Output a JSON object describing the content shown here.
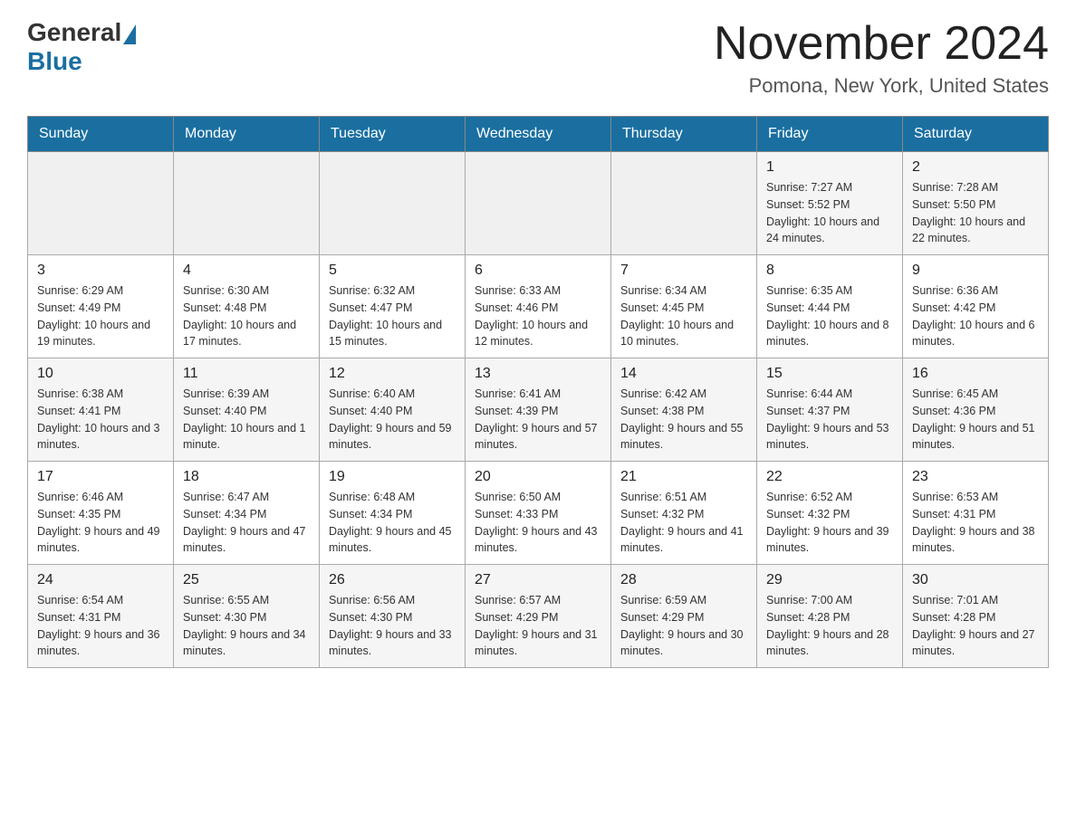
{
  "header": {
    "logo_general": "General",
    "logo_blue": "Blue",
    "month_title": "November 2024",
    "location": "Pomona, New York, United States"
  },
  "weekdays": [
    "Sunday",
    "Monday",
    "Tuesday",
    "Wednesday",
    "Thursday",
    "Friday",
    "Saturday"
  ],
  "weeks": [
    [
      {
        "day": "",
        "info": ""
      },
      {
        "day": "",
        "info": ""
      },
      {
        "day": "",
        "info": ""
      },
      {
        "day": "",
        "info": ""
      },
      {
        "day": "",
        "info": ""
      },
      {
        "day": "1",
        "info": "Sunrise: 7:27 AM\nSunset: 5:52 PM\nDaylight: 10 hours and 24 minutes."
      },
      {
        "day": "2",
        "info": "Sunrise: 7:28 AM\nSunset: 5:50 PM\nDaylight: 10 hours and 22 minutes."
      }
    ],
    [
      {
        "day": "3",
        "info": "Sunrise: 6:29 AM\nSunset: 4:49 PM\nDaylight: 10 hours and 19 minutes."
      },
      {
        "day": "4",
        "info": "Sunrise: 6:30 AM\nSunset: 4:48 PM\nDaylight: 10 hours and 17 minutes."
      },
      {
        "day": "5",
        "info": "Sunrise: 6:32 AM\nSunset: 4:47 PM\nDaylight: 10 hours and 15 minutes."
      },
      {
        "day": "6",
        "info": "Sunrise: 6:33 AM\nSunset: 4:46 PM\nDaylight: 10 hours and 12 minutes."
      },
      {
        "day": "7",
        "info": "Sunrise: 6:34 AM\nSunset: 4:45 PM\nDaylight: 10 hours and 10 minutes."
      },
      {
        "day": "8",
        "info": "Sunrise: 6:35 AM\nSunset: 4:44 PM\nDaylight: 10 hours and 8 minutes."
      },
      {
        "day": "9",
        "info": "Sunrise: 6:36 AM\nSunset: 4:42 PM\nDaylight: 10 hours and 6 minutes."
      }
    ],
    [
      {
        "day": "10",
        "info": "Sunrise: 6:38 AM\nSunset: 4:41 PM\nDaylight: 10 hours and 3 minutes."
      },
      {
        "day": "11",
        "info": "Sunrise: 6:39 AM\nSunset: 4:40 PM\nDaylight: 10 hours and 1 minute."
      },
      {
        "day": "12",
        "info": "Sunrise: 6:40 AM\nSunset: 4:40 PM\nDaylight: 9 hours and 59 minutes."
      },
      {
        "day": "13",
        "info": "Sunrise: 6:41 AM\nSunset: 4:39 PM\nDaylight: 9 hours and 57 minutes."
      },
      {
        "day": "14",
        "info": "Sunrise: 6:42 AM\nSunset: 4:38 PM\nDaylight: 9 hours and 55 minutes."
      },
      {
        "day": "15",
        "info": "Sunrise: 6:44 AM\nSunset: 4:37 PM\nDaylight: 9 hours and 53 minutes."
      },
      {
        "day": "16",
        "info": "Sunrise: 6:45 AM\nSunset: 4:36 PM\nDaylight: 9 hours and 51 minutes."
      }
    ],
    [
      {
        "day": "17",
        "info": "Sunrise: 6:46 AM\nSunset: 4:35 PM\nDaylight: 9 hours and 49 minutes."
      },
      {
        "day": "18",
        "info": "Sunrise: 6:47 AM\nSunset: 4:34 PM\nDaylight: 9 hours and 47 minutes."
      },
      {
        "day": "19",
        "info": "Sunrise: 6:48 AM\nSunset: 4:34 PM\nDaylight: 9 hours and 45 minutes."
      },
      {
        "day": "20",
        "info": "Sunrise: 6:50 AM\nSunset: 4:33 PM\nDaylight: 9 hours and 43 minutes."
      },
      {
        "day": "21",
        "info": "Sunrise: 6:51 AM\nSunset: 4:32 PM\nDaylight: 9 hours and 41 minutes."
      },
      {
        "day": "22",
        "info": "Sunrise: 6:52 AM\nSunset: 4:32 PM\nDaylight: 9 hours and 39 minutes."
      },
      {
        "day": "23",
        "info": "Sunrise: 6:53 AM\nSunset: 4:31 PM\nDaylight: 9 hours and 38 minutes."
      }
    ],
    [
      {
        "day": "24",
        "info": "Sunrise: 6:54 AM\nSunset: 4:31 PM\nDaylight: 9 hours and 36 minutes."
      },
      {
        "day": "25",
        "info": "Sunrise: 6:55 AM\nSunset: 4:30 PM\nDaylight: 9 hours and 34 minutes."
      },
      {
        "day": "26",
        "info": "Sunrise: 6:56 AM\nSunset: 4:30 PM\nDaylight: 9 hours and 33 minutes."
      },
      {
        "day": "27",
        "info": "Sunrise: 6:57 AM\nSunset: 4:29 PM\nDaylight: 9 hours and 31 minutes."
      },
      {
        "day": "28",
        "info": "Sunrise: 6:59 AM\nSunset: 4:29 PM\nDaylight: 9 hours and 30 minutes."
      },
      {
        "day": "29",
        "info": "Sunrise: 7:00 AM\nSunset: 4:28 PM\nDaylight: 9 hours and 28 minutes."
      },
      {
        "day": "30",
        "info": "Sunrise: 7:01 AM\nSunset: 4:28 PM\nDaylight: 9 hours and 27 minutes."
      }
    ]
  ]
}
